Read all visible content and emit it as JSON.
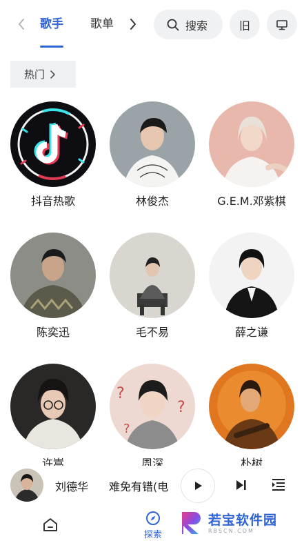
{
  "header": {
    "tabs": [
      {
        "label": "歌手",
        "active": true
      },
      {
        "label": "歌单",
        "active": false
      }
    ],
    "search_label": "搜索",
    "old_label": "旧",
    "accent_color": "#2f64d6"
  },
  "filter": {
    "label": "热门"
  },
  "artists": [
    {
      "name": "抖音热歌"
    },
    {
      "name": "林俊杰"
    },
    {
      "name": "G.E.M.邓紫棋"
    },
    {
      "name": "陈奕迅"
    },
    {
      "name": "毛不易"
    },
    {
      "name": "薛之谦"
    },
    {
      "name": "许嵩"
    },
    {
      "name": "周深"
    },
    {
      "name": "朴树"
    }
  ],
  "player": {
    "artist": "刘德华",
    "song": "难免有错(电"
  },
  "nav": {
    "explore_label": "探索"
  },
  "watermark": {
    "title": "若宝软件园",
    "sub": "RBSCN.COM"
  }
}
